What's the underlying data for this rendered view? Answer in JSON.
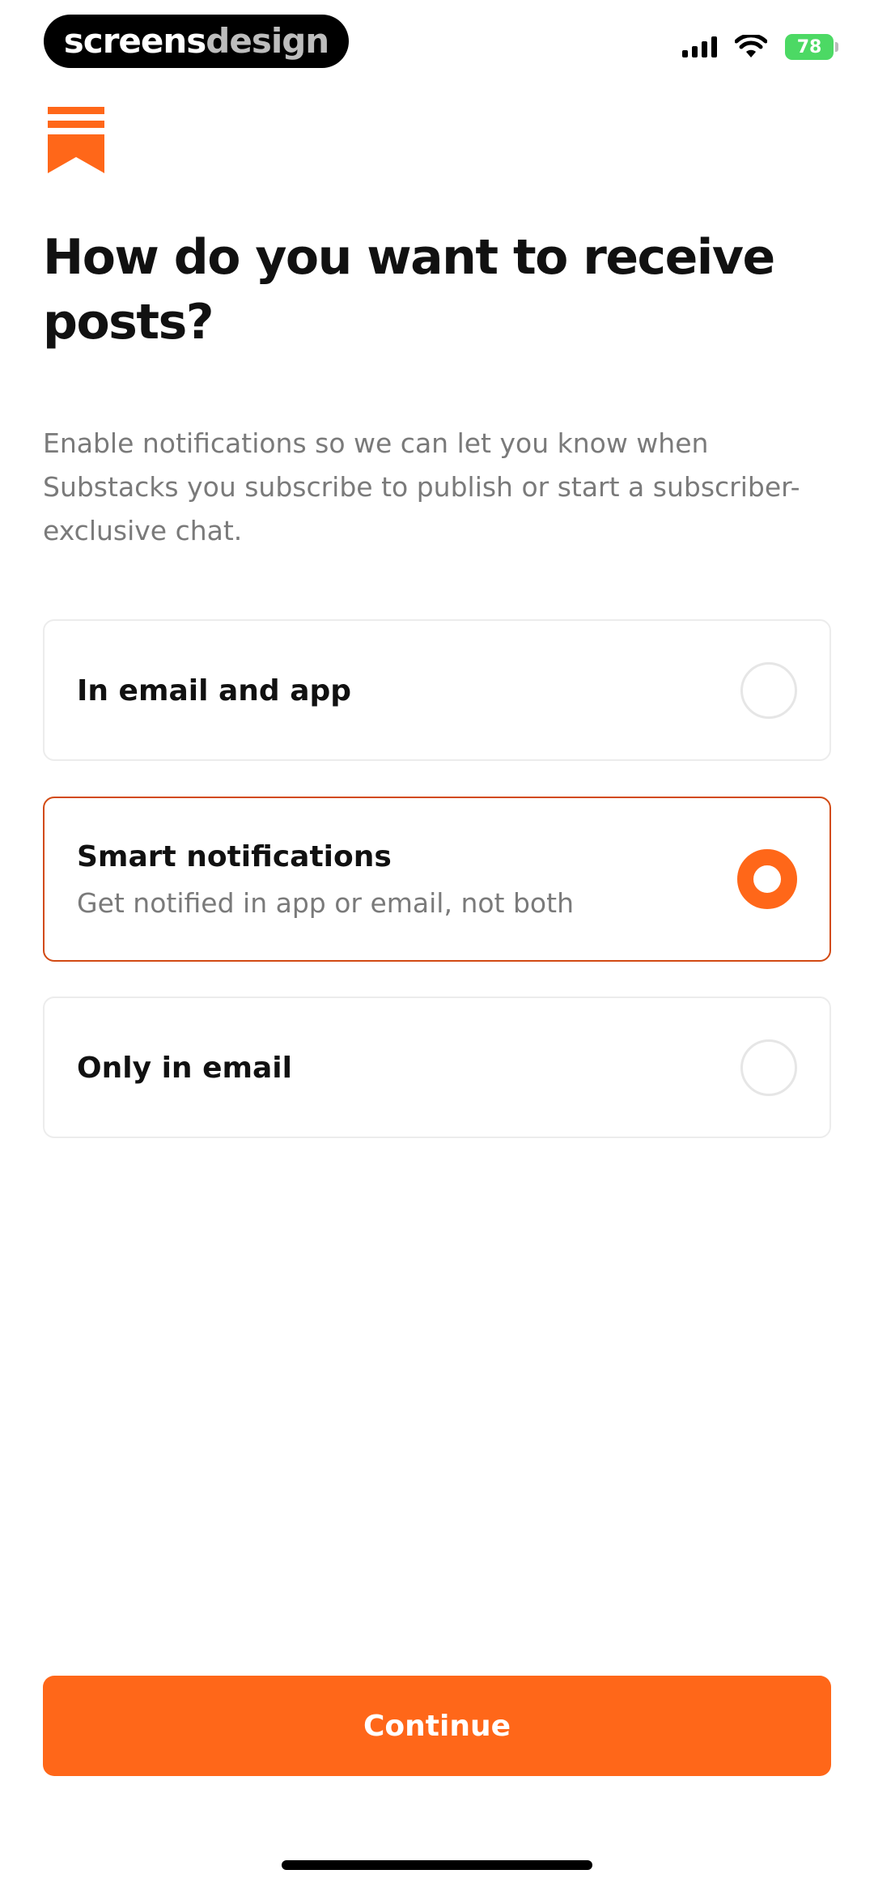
{
  "status_bar": {
    "watermark_part1": "screens",
    "watermark_part2": "design",
    "battery_level": "78",
    "icons": [
      "signal-icon",
      "wifi-icon",
      "battery-icon"
    ]
  },
  "logo": {
    "icon": "substack-bookmark-logo",
    "color": "#ff6719"
  },
  "heading": "How do you want to receive posts?",
  "description": "Enable notifications so we can let you know when Substacks you subscribe to publish or start a subscriber-exclusive chat.",
  "options": [
    {
      "title": "In email and app",
      "subtitle": "",
      "selected": false
    },
    {
      "title": "Smart notifications",
      "subtitle": "Get notified in app or email, not both",
      "selected": true
    },
    {
      "title": "Only in email",
      "subtitle": "",
      "selected": false
    }
  ],
  "continue_label": "Continue",
  "colors": {
    "accent": "#ff6719",
    "selected_border": "#d24a13",
    "text_primary": "#111111",
    "text_secondary": "#7a7a7a"
  }
}
